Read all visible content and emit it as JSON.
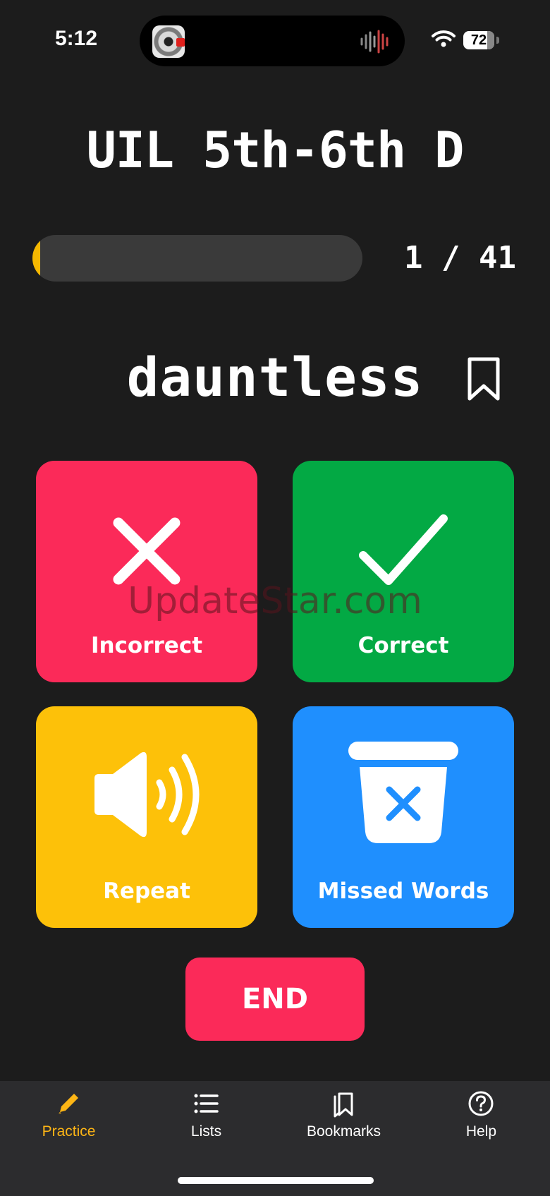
{
  "status_bar": {
    "time": "5:12",
    "battery": "72",
    "icons": [
      "wifi-icon",
      "battery-icon",
      "audio-waveform-icon",
      "app-icon"
    ]
  },
  "title": "UIL 5th-6th D",
  "progress": {
    "current": 1,
    "total": 41,
    "label": "1 / 41",
    "fill_color": "#f5b800"
  },
  "word": "dauntless",
  "bookmark": {
    "icon": "bookmark-icon"
  },
  "actions": {
    "incorrect": {
      "label": "Incorrect",
      "icon": "x-mark-icon",
      "color": "#fb2a59"
    },
    "correct": {
      "label": "Correct",
      "icon": "checkmark-icon",
      "color": "#03a944"
    },
    "repeat": {
      "label": "Repeat",
      "icon": "speaker-icon",
      "color": "#fdc109"
    },
    "missed": {
      "label": "Missed Words",
      "icon": "trash-x-icon",
      "color": "#1f8ffe"
    }
  },
  "watermark": "UpdateStar.com",
  "end_button": {
    "label": "END",
    "color": "#fb2a59"
  },
  "tabs": [
    {
      "label": "Practice",
      "icon": "pencil-icon",
      "active": true
    },
    {
      "label": "Lists",
      "icon": "list-icon",
      "active": false
    },
    {
      "label": "Bookmarks",
      "icon": "bookmarks-icon",
      "active": false
    },
    {
      "label": "Help",
      "icon": "help-icon",
      "active": false
    }
  ],
  "colors": {
    "background": "#1c1c1c",
    "tab_bar": "#2c2c2e",
    "active_tab": "#fdb515"
  }
}
